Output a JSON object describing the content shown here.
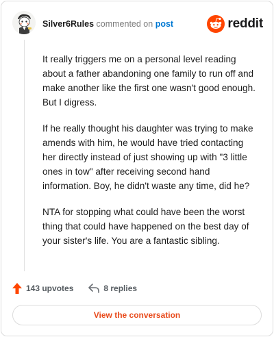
{
  "header": {
    "username": "Silver6Rules",
    "commented_on": "commented on",
    "post_link": "post"
  },
  "brand": {
    "wordmark": "reddit",
    "color": "#ff4500"
  },
  "comment": {
    "paragraphs": [
      "It really triggers me on a personal level reading about a father abandoning one family to run off and make another like the first one wasn't good enough. But I digress.",
      "If he really thought his daughter was trying to make amends with him, he would have tried contacting her directly instead of just showing up with \"3 little ones in tow\" after receiving second hand information. Boy, he didn't waste any time, did he?",
      "NTA for stopping what could have been the worst thing that could have happened on the best day of your sister's life. You are a fantastic sibling."
    ]
  },
  "footer": {
    "upvotes": "143 upvotes",
    "replies": "8 replies"
  },
  "cta": {
    "label": "View the conversation",
    "color": "#e8491a"
  },
  "icons": {
    "avatar": "snoo-avatar-icon",
    "brand": "reddit-logo-icon",
    "upvote": "upvote-arrow-icon",
    "reply": "reply-arrow-icon"
  }
}
